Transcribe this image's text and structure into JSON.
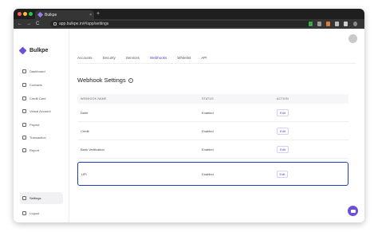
{
  "browser": {
    "tab_title": "Bulkpe",
    "new_tab": "+",
    "close": "×",
    "url": "app.bulkpe.in/#/app/settings",
    "back": "←",
    "forward": "→",
    "reload": "C"
  },
  "sidebar": {
    "brand": "Bulkpe",
    "items": [
      {
        "label": "Dashboard",
        "icon": "dashboard-icon"
      },
      {
        "label": "Contacts",
        "icon": "contacts-icon"
      },
      {
        "label": "Credit Card",
        "icon": "credit-card-icon"
      },
      {
        "label": "Virtual Account",
        "icon": "virtual-account-icon"
      },
      {
        "label": "Payout",
        "icon": "payout-icon"
      },
      {
        "label": "Transaction",
        "icon": "transaction-icon"
      },
      {
        "label": "Report",
        "icon": "report-icon"
      }
    ],
    "settings": "Settings",
    "logout": "Logout"
  },
  "tabs": [
    "Accounts",
    "Security",
    "Services",
    "Webhooks",
    "Whitelist",
    "API"
  ],
  "active_tab": "Webhooks",
  "page_title": "Webhook Settings",
  "table": {
    "headers": [
      "WEBHOOK NAME",
      "STATUS",
      "ACTION"
    ],
    "rows": [
      {
        "name": "Debit",
        "status": "Enabled",
        "action": "Edit"
      },
      {
        "name": "Credit",
        "status": "Enabled",
        "action": "Edit"
      },
      {
        "name": "Bank Verification",
        "status": "Enabled",
        "action": "Edit"
      },
      {
        "name": "UPI",
        "status": "Enabled",
        "action": "Edit"
      }
    ]
  },
  "colors": {
    "accent": "#5b40c8",
    "highlight_border": "#1e3dbb",
    "brand": "#6d4fd8"
  }
}
